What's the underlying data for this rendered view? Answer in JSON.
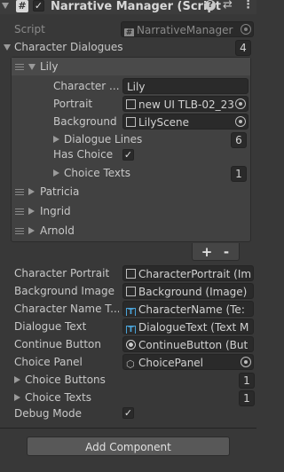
{
  "component": {
    "title": "Narrative Manager (Script",
    "enabled": true
  },
  "script": {
    "label": "Script",
    "value": "NarrativeManager"
  },
  "character_dialogues": {
    "label": "Character Dialogues",
    "count": "4",
    "elements": [
      {
        "name": "Lily",
        "expanded": true,
        "fields": {
          "character_label": "Character ...",
          "character_value": "Lily",
          "portrait_label": "Portrait",
          "portrait_value": "new UI TLB-02_23",
          "background_label": "Background",
          "background_value": "LilyScene",
          "dialogue_lines_label": "Dialogue Lines",
          "dialogue_lines_count": "6",
          "has_choice_label": "Has Choice",
          "has_choice_checked": true,
          "choice_texts_label": "Choice Texts",
          "choice_texts_count": "1"
        }
      },
      {
        "name": "Patricia"
      },
      {
        "name": "Ingrid"
      },
      {
        "name": "Arnold"
      }
    ],
    "add_label": "+",
    "remove_label": "-"
  },
  "fields": {
    "character_portrait_label": "Character Portrait",
    "character_portrait_value": "CharacterPortrait (Im",
    "background_image_label": "Background Image",
    "background_image_value": "Background (Image)",
    "character_name_label": "Character Name T...",
    "character_name_value": "CharacterName (Te:",
    "dialogue_text_label": "Dialogue Text",
    "dialogue_text_value": "DialogueText (Text M",
    "continue_button_label": "Continue Button",
    "continue_button_value": "ContinueButton (But",
    "choice_panel_label": "Choice Panel",
    "choice_panel_value": "ChoicePanel",
    "choice_buttons_label": "Choice Buttons",
    "choice_buttons_count": "1",
    "choice_texts_label": "Choice Texts",
    "choice_texts_count": "1",
    "debug_mode_label": "Debug Mode",
    "debug_mode_checked": true
  },
  "add_component_label": "Add Component",
  "icons": [
    "hash-script-icon",
    "help-icon",
    "settings-sliders-icon",
    "more-icon",
    "image-icon",
    "text-icon",
    "button-icon",
    "gameobject-icon",
    "object-picker-icon"
  ]
}
